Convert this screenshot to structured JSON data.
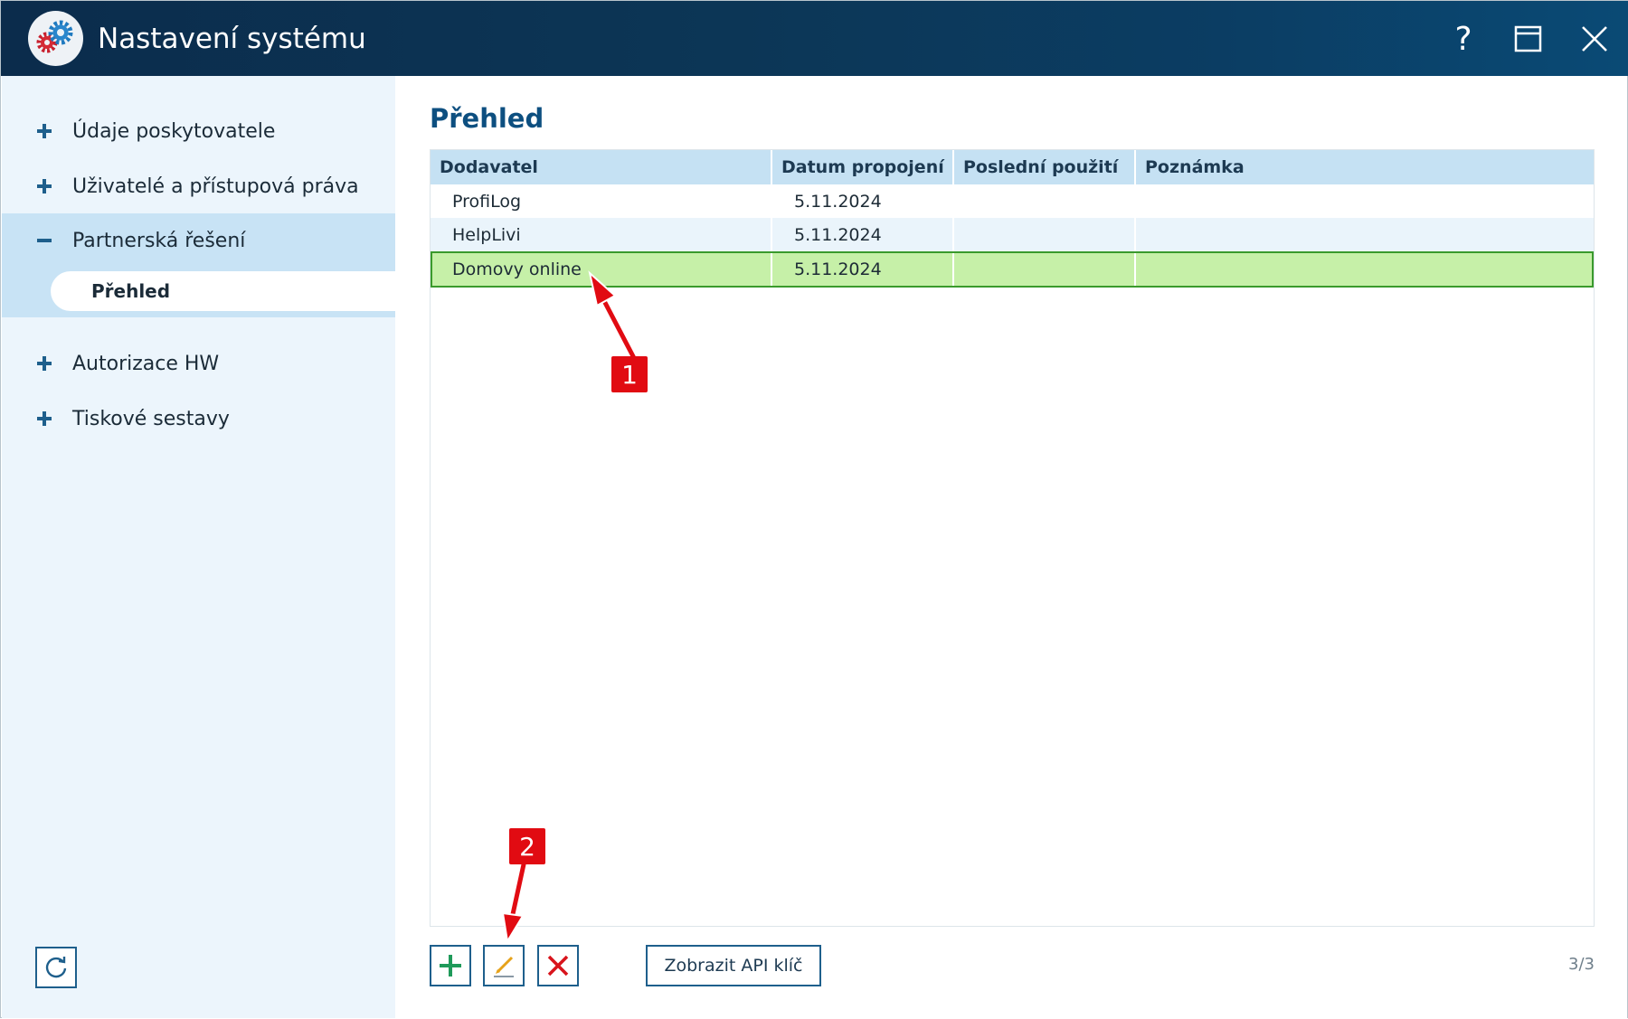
{
  "window": {
    "title": "Nastavení systému",
    "help_glyph": "?"
  },
  "sidebar": {
    "items": [
      {
        "label": "Údaje poskytovatele",
        "expanded": false
      },
      {
        "label": "Uživatelé a přístupová práva",
        "expanded": false
      },
      {
        "label": "Partnerská řešení",
        "expanded": true,
        "children": [
          {
            "label": "Přehled",
            "selected": true
          }
        ]
      },
      {
        "label": "Autorizace HW",
        "expanded": false
      },
      {
        "label": "Tiskové sestavy",
        "expanded": false
      }
    ]
  },
  "main": {
    "page_title": "Přehled",
    "table": {
      "columns": [
        "Dodavatel",
        "Datum propojení",
        "Poslední použití",
        "Poznámka"
      ],
      "rows": [
        {
          "cells": [
            "ProfiLog",
            "5.11.2024",
            "",
            ""
          ],
          "selected": false
        },
        {
          "cells": [
            "HelpLivi",
            "5.11.2024",
            "",
            ""
          ],
          "selected": false
        },
        {
          "cells": [
            "Domovy online",
            "5.11.2024",
            "",
            ""
          ],
          "selected": true
        }
      ]
    },
    "toolbar": {
      "add_icon": "plus-icon",
      "edit_icon": "pencil-icon",
      "delete_icon": "x-icon",
      "api_key_label": "Zobrazit API klíč",
      "counter": "3/3"
    }
  },
  "annotations": {
    "callout_1": "1",
    "callout_2": "2"
  },
  "colors": {
    "titlebar": "#0b3d63",
    "accent": "#0d4f80",
    "selected_row": "#c6f0a8",
    "selected_row_border": "#3a9a2c",
    "callout": "#e10b12",
    "add_icon": "#1f9a5a",
    "delete_icon": "#d8141c",
    "edit_icon": "#e6a21a"
  }
}
